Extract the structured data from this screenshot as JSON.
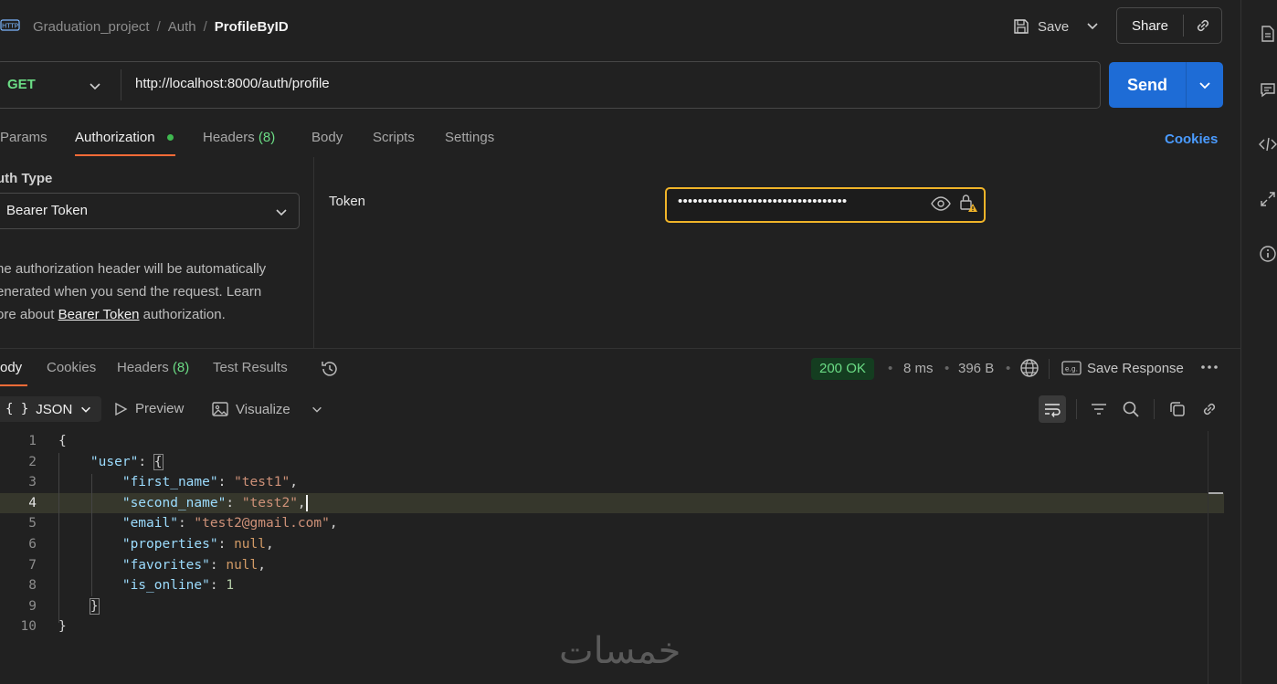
{
  "topbar": {
    "breadcrumb": [
      "Graduation_project",
      "Auth"
    ],
    "current": "ProfileByID",
    "save_label": "Save",
    "share_label": "Share"
  },
  "request": {
    "method": "GET",
    "url": "http://localhost:8000/auth/profile",
    "send_label": "Send"
  },
  "request_tabs": {
    "params": "Params",
    "authorization": "Authorization",
    "headers": "Headers",
    "headers_count": "(8)",
    "body": "Body",
    "scripts": "Scripts",
    "settings": "Settings",
    "cookies": "Cookies",
    "active": "Authorization"
  },
  "auth": {
    "type_label": "uth Type",
    "type_value": "Bearer Token",
    "desc_1": "he authorization header will be automatically",
    "desc_2": "enerated when you send the request. Learn",
    "desc_3": "ore about ",
    "desc_link": "Bearer Token",
    "desc_4": " authorization.",
    "token_label": "Token",
    "token_mask": "••••••••••••••••••••••••••••••••••"
  },
  "response_tabs": {
    "body": "ody",
    "cookies": "Cookies",
    "headers": "Headers",
    "headers_count": "(8)",
    "test_results": "Test Results"
  },
  "response_meta": {
    "status": "200 OK",
    "time": "8 ms",
    "size": "396 B",
    "save_response": "Save Response"
  },
  "view": {
    "format": "JSON",
    "format_braces": "{ }",
    "preview": "Preview",
    "visualize": "Visualize"
  },
  "code_lines": [
    {
      "n": "1"
    },
    {
      "n": "2"
    },
    {
      "n": "3"
    },
    {
      "n": "4"
    },
    {
      "n": "5"
    },
    {
      "n": "6"
    },
    {
      "n": "7"
    },
    {
      "n": "8"
    },
    {
      "n": "9"
    },
    {
      "n": "10"
    }
  ],
  "json": {
    "key_user": "\"user\"",
    "key_first_name": "\"first_name\"",
    "val_first_name": "\"test1\"",
    "key_second_name": "\"second_name\"",
    "val_second_name": "\"test2\"",
    "key_email": "\"email\"",
    "val_email": "\"test2@gmail.com\"",
    "key_properties": "\"properties\"",
    "val_properties": "null",
    "key_favorites": "\"favorites\"",
    "val_favorites": "null",
    "key_is_online": "\"is_online\"",
    "val_is_online": "1"
  },
  "watermark": "خمسات",
  "colors": {
    "accent": "#ff6c37",
    "send": "#1e6cd6",
    "method": "#6bdc85",
    "status_ok": "#6bdc85",
    "token_border": "#f0b429",
    "link": "#4a9bff"
  },
  "icons": {
    "http": "http-icon",
    "save": "floppy-icon",
    "share_link": "link-icon",
    "eye": "eye-icon",
    "lock": "lock-warning-icon",
    "history": "history-icon",
    "globe": "globe-icon"
  }
}
